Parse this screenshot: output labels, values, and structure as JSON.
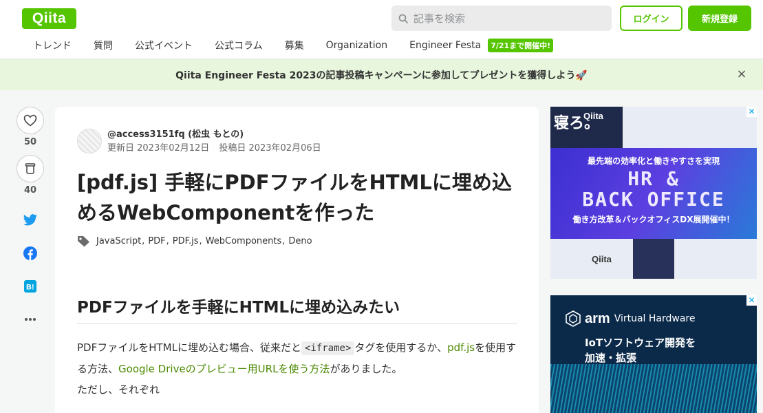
{
  "header": {
    "logo": "Qiita",
    "search_placeholder": "記事を検索",
    "login": "ログイン",
    "signup": "新規登録"
  },
  "nav": {
    "items": [
      "トレンド",
      "質問",
      "公式イベント",
      "公式コラム",
      "募集",
      "Organization",
      "Engineer Festa"
    ],
    "badge": "7/21まで開催中!"
  },
  "banner": {
    "text": "Qiita Engineer Festa 2023の記事投稿キャンペーンに参加してプレゼントを獲得しよう🚀",
    "close": "×"
  },
  "side": {
    "likes": "50",
    "stocks": "40"
  },
  "article": {
    "author": "@access3151fq (松虫 もとの)",
    "updated": "更新日 2023年02月12日",
    "posted": "投稿日 2023年02月06日",
    "title": "[pdf.js] 手軽にPDFファイルをHTMLに埋め込めるWebComponentを作った",
    "tags": [
      "JavaScript",
      "PDF",
      "PDF.js",
      "WebComponents",
      "Deno"
    ],
    "h2": "PDFファイルを手軽にHTMLに埋め込みたい",
    "p1_a": "PDFファイルをHTMLに埋め込む場合、従来だと",
    "p1_code": "<iframe>",
    "p1_b": "タグを使用するか、",
    "p1_link1": "pdf.js",
    "p1_c": "を使用する方法、",
    "p1_link2": "Google Driveのプレビュー用URLを使う方法",
    "p1_d": "がありました。",
    "p2": "ただし、それぞれ"
  },
  "ads": {
    "ad1": {
      "qiita": "Qiita",
      "kanji": "寝ろ。",
      "sub": "最先端の効率化と働きやすさを実現",
      "hr": "HR &",
      "bo": "BACK OFFICE",
      "sub2": "働き方改革＆バックオフィスDX展開催中！"
    },
    "ad2": {
      "brand": "arm",
      "product": "Virtual Hardware",
      "line1": "IoTソフトウェア開発を",
      "line2": "加速・拡張"
    },
    "adchoice": "✕"
  },
  "colors": {
    "brand": "#55c500",
    "banner_bg": "#e7f6dc",
    "link": "#4a8a00"
  }
}
